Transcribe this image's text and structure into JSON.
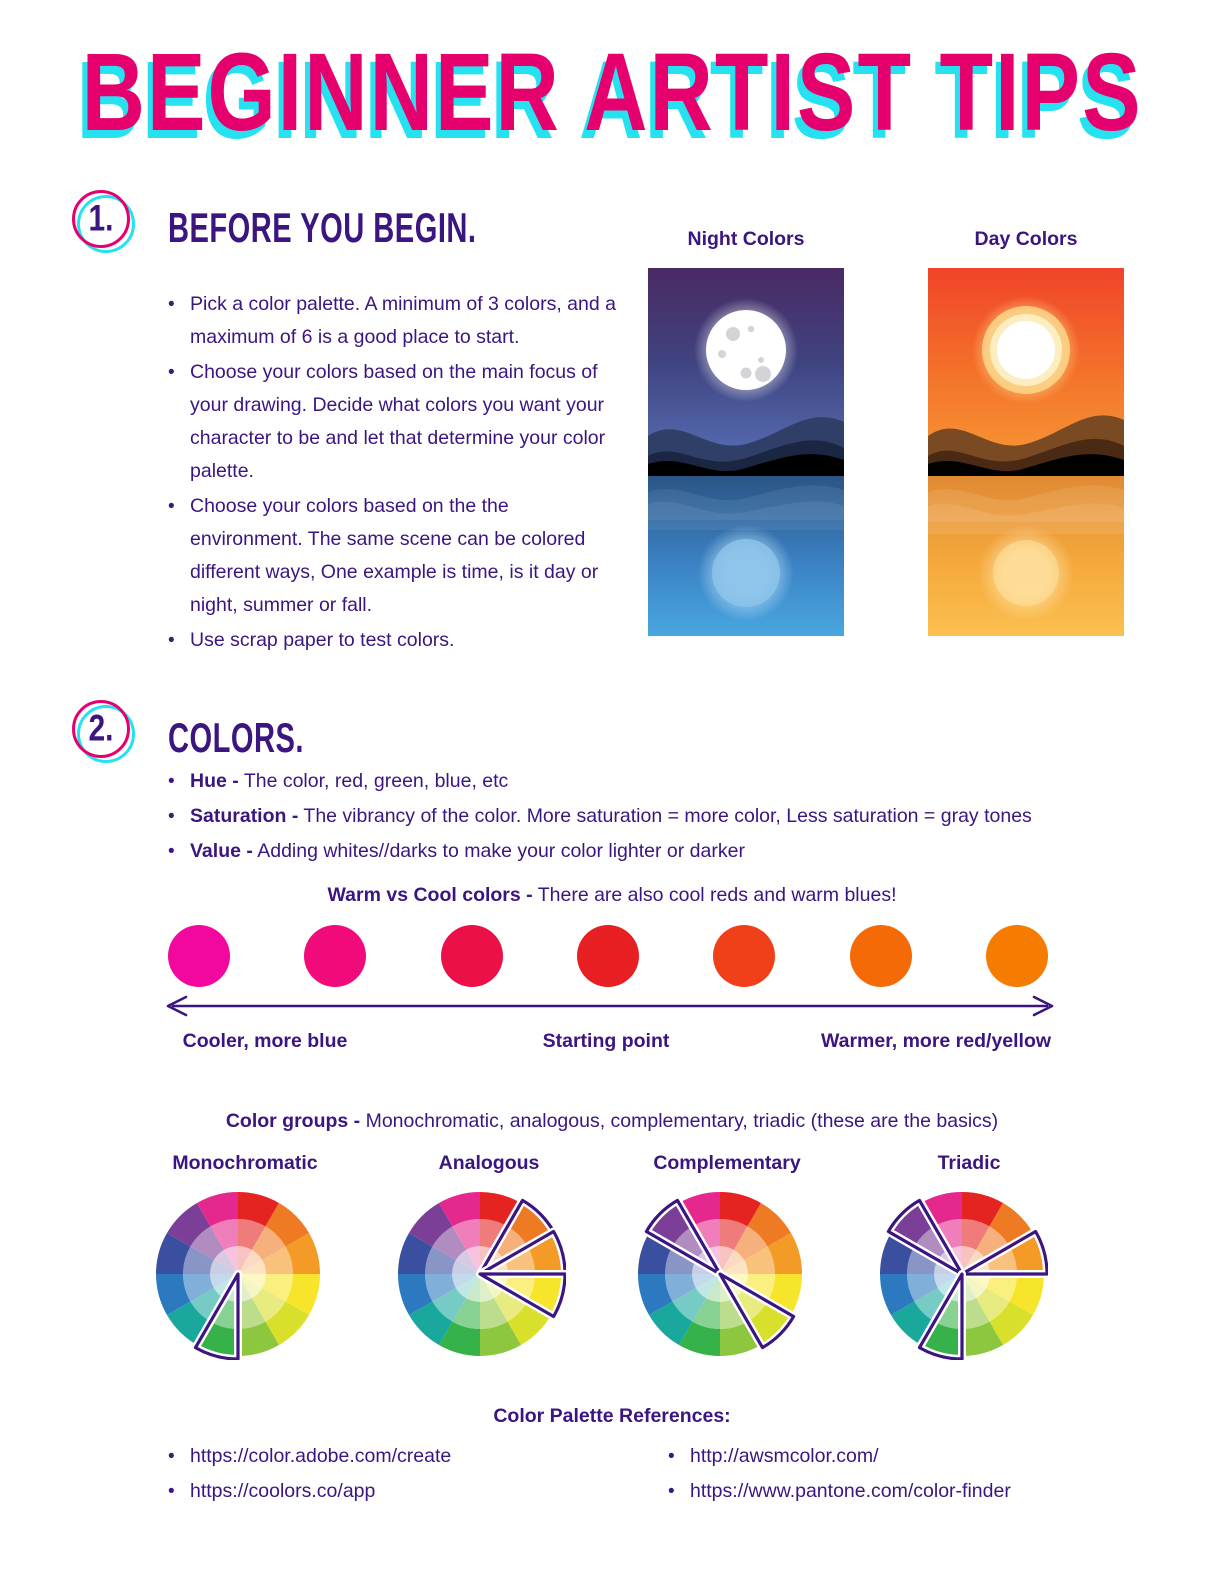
{
  "document": {
    "title": "BEGINNER ARTIST TIPS",
    "title_color": "#E6006E",
    "title_shadow_color": "#26E1F0",
    "text_color": "#3b1580"
  },
  "sections": [
    {
      "number": "1.",
      "heading": "BEFORE YOU BEGIN.",
      "bullets": [
        "Pick a color palette. A minimum of 3 colors, and a maximum of 6 is a good place to start.",
        "Choose your colors based on the main focus of your drawing. Decide what colors you want your character to be and let that determine your color palette.",
        "Choose your colors based on the the environment. The same scene can be colored different ways, One example is time, is it day or night, summer or fall.",
        "Use scrap paper to test colors."
      ]
    },
    {
      "number": "2.",
      "heading": "COLORS.",
      "definitions": [
        {
          "term": "Hue -",
          "text": " The color, red, green, blue, etc"
        },
        {
          "term": "Saturation -",
          "text": " The vibrancy of the color. More saturation = more color, Less saturation = gray tones"
        },
        {
          "term": "Value -",
          "text": " Adding whites//darks to make your color lighter or darker"
        }
      ]
    }
  ],
  "illustrations": [
    {
      "label": "Night Colors",
      "type": "night"
    },
    {
      "label": "Day Colors",
      "type": "day"
    }
  ],
  "warm_cool": {
    "heading_bold": "Warm vs Cool colors -",
    "heading_rest": " There are also cool reds and warm blues!",
    "swatches": [
      {
        "color": "#F2089F"
      },
      {
        "color": "#F10B7A"
      },
      {
        "color": "#EB1148"
      },
      {
        "color": "#E81F22"
      },
      {
        "color": "#F0401A"
      },
      {
        "color": "#F46A06"
      },
      {
        "color": "#F57C00"
      }
    ],
    "labels": {
      "left": "Cooler, more blue",
      "center": "Starting point",
      "right": "Warmer, more red/yellow"
    }
  },
  "color_groups": {
    "heading_bold": "Color groups -",
    "heading_rest": " Monochromatic, analogous, complementary, triadic (these are the basics)",
    "wheels": [
      {
        "label": "Monochromatic",
        "selected_sectors": [
          6
        ]
      },
      {
        "label": "Analogous",
        "selected_sectors": [
          1,
          2,
          3
        ]
      },
      {
        "label": "Complementary",
        "selected_sectors": [
          10,
          4
        ]
      },
      {
        "label": "Triadic",
        "selected_sectors": [
          10,
          2,
          6
        ]
      }
    ],
    "wheel_hues": [
      "#E52421",
      "#EE7B23",
      "#F49A26",
      "#F6E52A",
      "#D9E02B",
      "#8DC63F",
      "#37B24A",
      "#1BA89C",
      "#2C79C0",
      "#3B4FA0",
      "#7B3F98",
      "#E5288E"
    ]
  },
  "references": {
    "heading": "Color Palette References:",
    "left_column": [
      "https://color.adobe.com/create",
      "https://coolors.co/app"
    ],
    "right_column": [
      "http://awsmcolor.com/",
      "https://www.pantone.com/color-finder"
    ]
  }
}
